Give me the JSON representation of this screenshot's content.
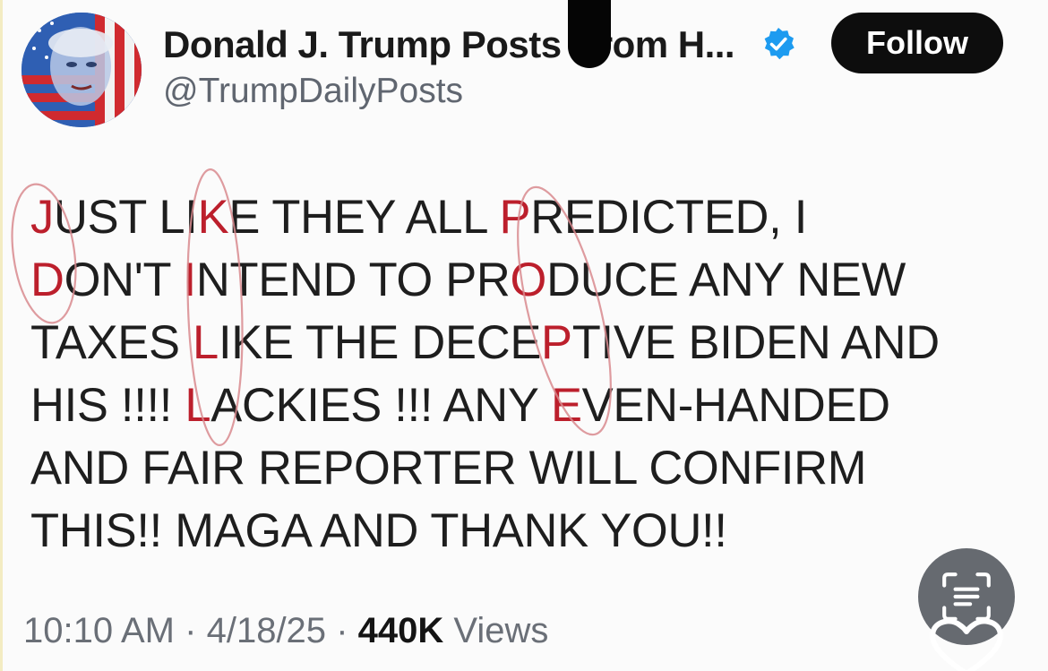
{
  "post": {
    "author": {
      "display_name": "Donald J. Trump Posts",
      "display_name_tail": "rom H...",
      "handle": "@TrumpDailyPosts",
      "verified": true
    },
    "follow_label": "Follow",
    "body_lines": [
      [
        {
          "t": "J",
          "h": true
        },
        {
          "t": "UST L",
          "h": false
        },
        {
          "t": "I",
          "h": false
        },
        {
          "t": "K",
          "h": true
        },
        {
          "t": "E THEY ALL ",
          "h": false
        },
        {
          "t": "P",
          "h": true
        },
        {
          "t": "REDICTED, I",
          "h": false
        }
      ],
      [
        {
          "t": "D",
          "h": true
        },
        {
          "t": "ON'T ",
          "h": false
        },
        {
          "t": "I",
          "h": true
        },
        {
          "t": "NTEND TO PR",
          "h": false
        },
        {
          "t": "O",
          "h": true
        },
        {
          "t": "DUCE ANY NEW",
          "h": false
        }
      ],
      [
        {
          "t": "TAXES ",
          "h": false
        },
        {
          "t": "L",
          "h": true
        },
        {
          "t": "IKE THE DECE",
          "h": false
        },
        {
          "t": "P",
          "h": true
        },
        {
          "t": "TIVE BIDEN AND",
          "h": false
        }
      ],
      [
        {
          "t": "HIS !!!! ",
          "h": false
        },
        {
          "t": "L",
          "h": true
        },
        {
          "t": "ACKIES !!! ANY ",
          "h": false
        },
        {
          "t": "E",
          "h": true
        },
        {
          "t": "VEN-HANDED",
          "h": false
        }
      ],
      [
        {
          "t": "AND FAIR REPORTER WILL CONFIRM",
          "h": false
        }
      ],
      [
        {
          "t": "THIS!! MAGA AND THANK YOU!!",
          "h": false
        }
      ]
    ],
    "time": "10:10 AM",
    "date": "4/18/25",
    "views_count": "440K",
    "views_label": "Views",
    "separator": "·"
  },
  "icons": {
    "verified": "verified-badge-icon",
    "lens": "visual-lookup-icon",
    "heart": "heart-outline-icon"
  },
  "colors": {
    "highlight": "#bc1f2c",
    "verified": "#1d9bf0",
    "follow_bg": "#0d0d0d",
    "circle_stroke": "#d88a8e"
  }
}
